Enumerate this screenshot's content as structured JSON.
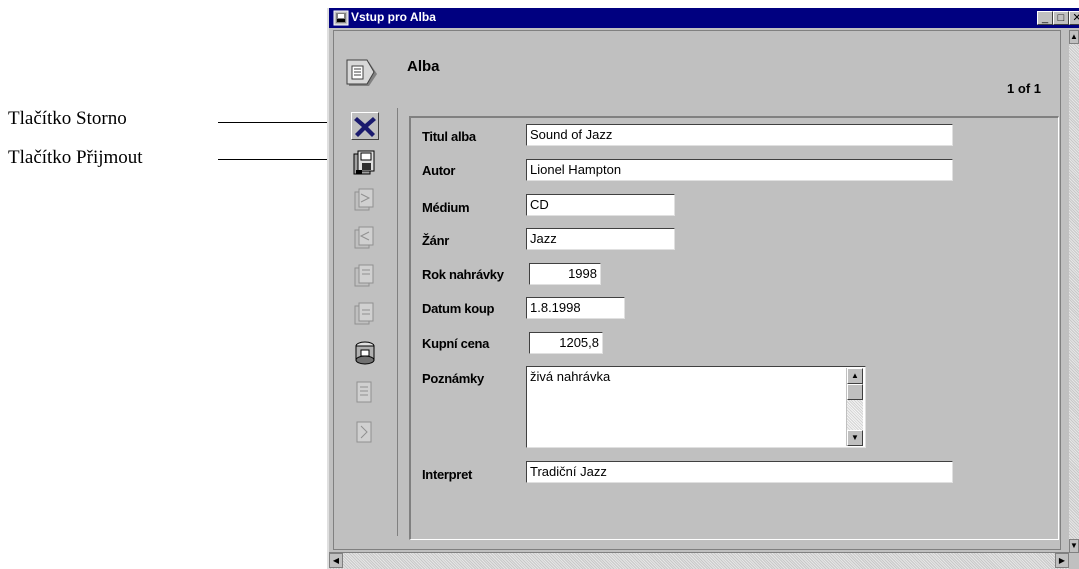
{
  "annotations": {
    "cancel": "Tlačítko Storno",
    "accept": "Tlačítko Přijmout"
  },
  "window": {
    "title": "Vstup pro Alba",
    "minimize_glyph": "_",
    "maximize_glyph": "□",
    "close_glyph": "✕"
  },
  "header": {
    "title": "Alba",
    "record_count": "1 of 1"
  },
  "fields": {
    "titul_alba": {
      "label": "Titul alba",
      "value": "Sound of Jazz"
    },
    "autor": {
      "label": "Autor",
      "value": "Lionel Hampton"
    },
    "medium": {
      "label": "Médium",
      "value": "CD"
    },
    "zanr": {
      "label": "Žánr",
      "value": "Jazz"
    },
    "rok_nahravky": {
      "label": "Rok nahrávky",
      "value": "1998"
    },
    "datum_koup": {
      "label": "Datum koup",
      "value": "1.8.1998"
    },
    "kupni_cena": {
      "label": "Kupní cena",
      "value": "1205,8"
    },
    "poznamky": {
      "label": "Poznámky",
      "value": "živá nahrávka"
    },
    "interpret": {
      "label": "Interpret",
      "value": "Tradiční Jazz"
    }
  },
  "toolbar": [
    {
      "icon": "cancel-x-icon",
      "enabled": true
    },
    {
      "icon": "accept-disk-icon",
      "enabled": true
    },
    {
      "icon": "record-icon",
      "enabled": false
    },
    {
      "icon": "record-icon",
      "enabled": false
    },
    {
      "icon": "record-icon",
      "enabled": false
    },
    {
      "icon": "record-icon",
      "enabled": false
    },
    {
      "icon": "print-icon",
      "enabled": true
    },
    {
      "icon": "record-icon",
      "enabled": false
    },
    {
      "icon": "record-icon",
      "enabled": false
    }
  ],
  "colors": {
    "titlebar": "#000080",
    "window_bg": "#c0c0c0",
    "cancel_x": "#1a1a6e"
  }
}
